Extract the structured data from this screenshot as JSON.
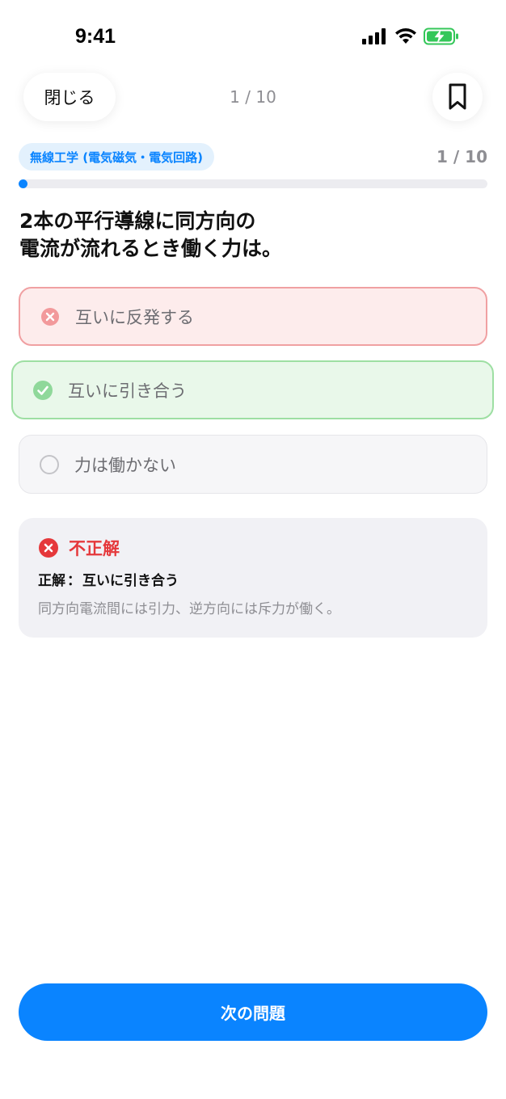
{
  "status_bar": {
    "time": "9:41"
  },
  "topbar": {
    "close_label": "閉じる",
    "counter": "1 / 10"
  },
  "quiz": {
    "category": "無線工学 (電気磁気・電気回路)",
    "progress_text": "1 / 10",
    "progress_fraction": 0.01,
    "question_lines": [
      "2本の平行導線に同方向の",
      "電流が流れるとき働く力は。"
    ],
    "options": [
      {
        "label": "互いに反発する",
        "state": "wrong"
      },
      {
        "label": "互いに引き合う",
        "state": "correct"
      },
      {
        "label": "力は働かない",
        "state": "neutral"
      }
    ]
  },
  "feedback": {
    "title": "不正解",
    "answer_prefix": "正解",
    "answer_separator": "：",
    "answer_text": "互いに引き合う",
    "explanation": "同方向電流間には引力、逆方向には斥力が働く。"
  },
  "next_button": {
    "label": "次の問題"
  },
  "colors": {
    "accent": "#0a84ff",
    "wrong": "#e5383b",
    "correct": "#34c759"
  }
}
